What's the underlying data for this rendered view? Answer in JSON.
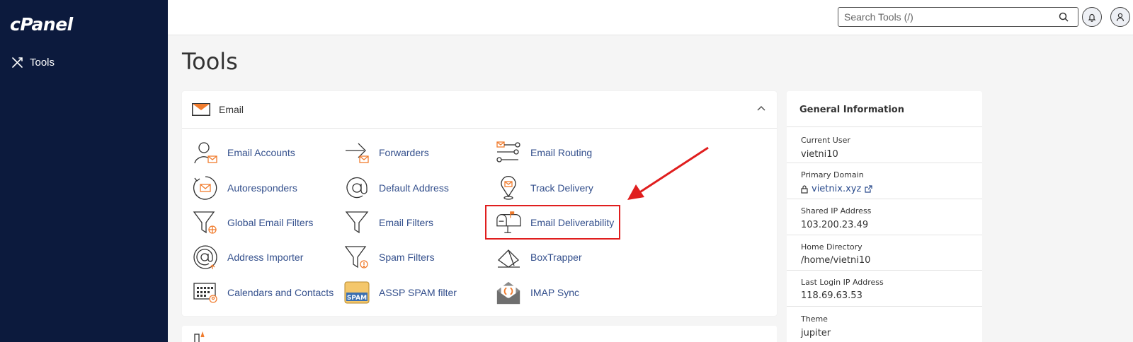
{
  "sidebar": {
    "logo": "cPanel",
    "items": [
      {
        "label": "Tools",
        "icon": "tools-icon"
      }
    ]
  },
  "header": {
    "search_placeholder": "Search Tools (/)",
    "notifications_icon": "bell-icon",
    "user_icon": "user-icon"
  },
  "page": {
    "title": "Tools"
  },
  "email_section": {
    "title": "Email",
    "icon": "envelope-icon",
    "collapse_icon": "chevron-up-icon",
    "tools": [
      {
        "label": "Email Accounts",
        "icon": "email-accounts-icon"
      },
      {
        "label": "Forwarders",
        "icon": "forwarders-icon"
      },
      {
        "label": "Email Routing",
        "icon": "email-routing-icon"
      },
      {
        "label": "Autoresponders",
        "icon": "autoresponders-icon"
      },
      {
        "label": "Default Address",
        "icon": "at-sign-icon"
      },
      {
        "label": "Track Delivery",
        "icon": "track-delivery-icon"
      },
      {
        "label": "Global Email Filters",
        "icon": "global-filter-icon"
      },
      {
        "label": "Email Filters",
        "icon": "filter-icon"
      },
      {
        "label": "Email Deliverability",
        "icon": "mailbox-icon"
      },
      {
        "label": "Address Importer",
        "icon": "address-importer-icon"
      },
      {
        "label": "Spam Filters",
        "icon": "spam-filter-icon"
      },
      {
        "label": "BoxTrapper",
        "icon": "boxtrapper-icon"
      },
      {
        "label": "Calendars and Contacts",
        "icon": "calendar-icon"
      },
      {
        "label": "ASSP SPAM filter",
        "icon": "assp-spam-icon"
      },
      {
        "label": "IMAP Sync",
        "icon": "imap-sync-icon"
      }
    ],
    "spam_badge": "SPAM"
  },
  "general_info": {
    "title": "General Information",
    "rows": [
      {
        "label": "Current User",
        "value": "vietni10"
      },
      {
        "label": "Primary Domain",
        "value": "vietnix.xyz"
      },
      {
        "label": "Shared IP Address",
        "value": "103.200.23.49"
      },
      {
        "label": "Home Directory",
        "value": "/home/vietni10"
      },
      {
        "label": "Last Login IP Address",
        "value": "118.69.63.53"
      },
      {
        "label": "Theme",
        "value": "jupiter"
      }
    ]
  },
  "colors": {
    "sidebar_bg": "#0c1a3d",
    "accent_orange": "#f07c2e",
    "link_blue": "#334f8c",
    "highlight_red": "#e01e1e"
  }
}
